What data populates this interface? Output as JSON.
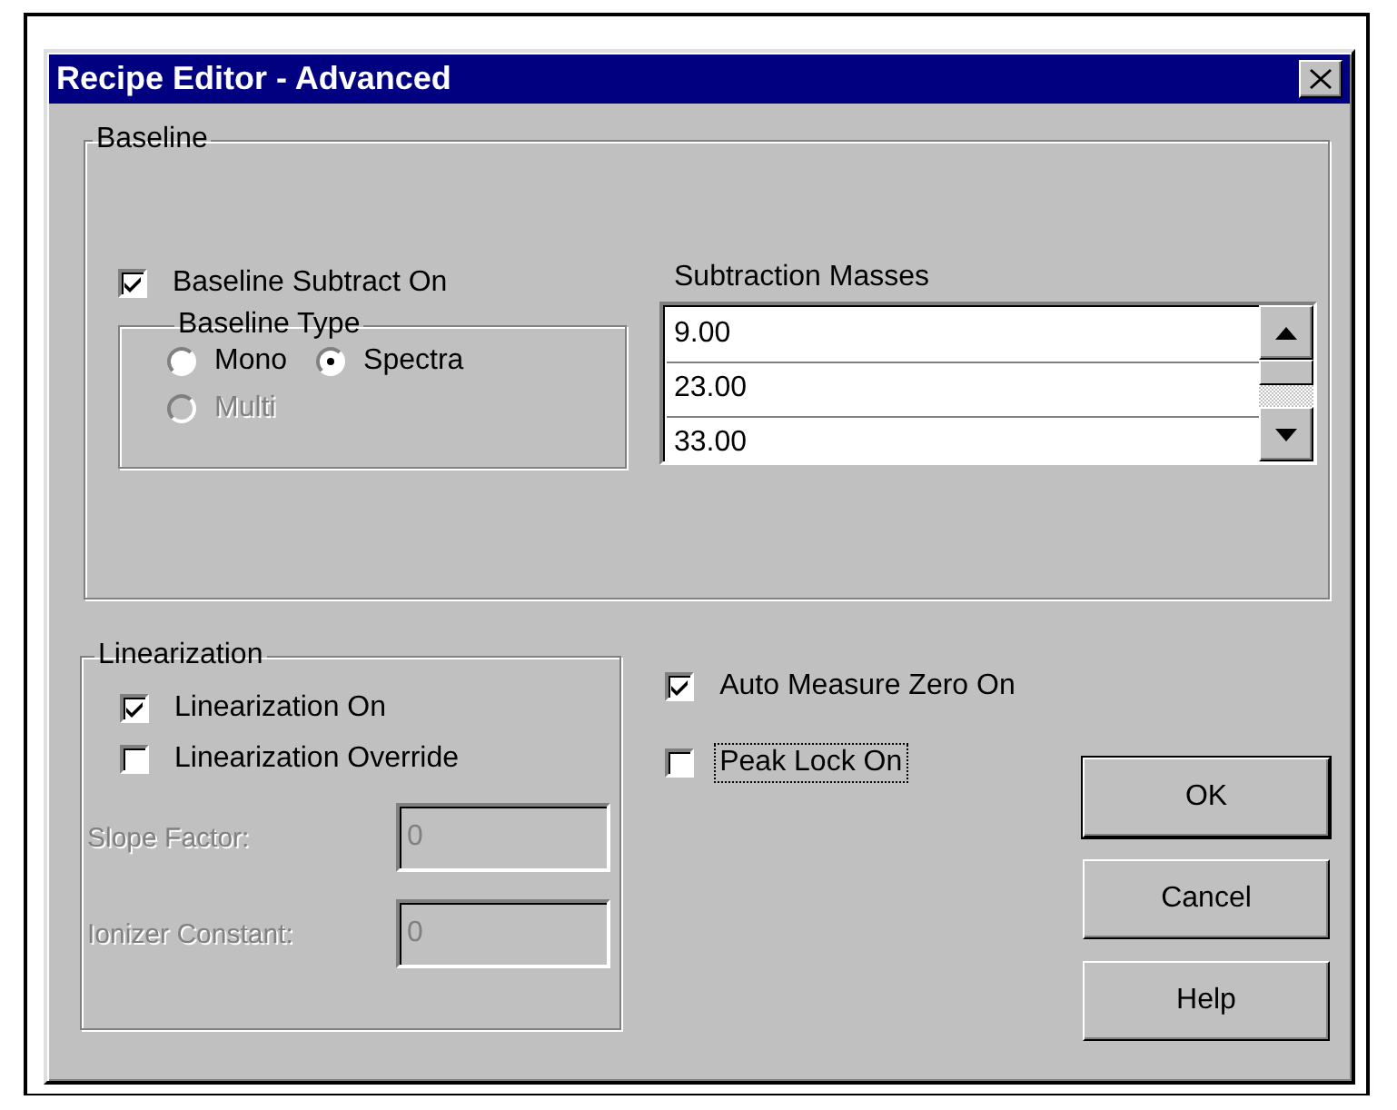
{
  "window": {
    "title": "Recipe Editor - Advanced"
  },
  "baseline": {
    "title": "Baseline",
    "subtract": {
      "label": "Baseline Subtract On",
      "checked": true
    },
    "type_group": {
      "title": "Baseline Type",
      "options": [
        {
          "label": "Mono",
          "selected": false,
          "disabled": false
        },
        {
          "label": "Spectra",
          "selected": true,
          "disabled": false
        },
        {
          "label": "Multi",
          "selected": false,
          "disabled": true
        }
      ]
    },
    "masses": {
      "label": "Subtraction Masses",
      "rows": [
        "9.00",
        "23.00",
        "33.00"
      ]
    }
  },
  "linearization": {
    "title": "Linearization",
    "checks": [
      {
        "label": "Linearization On",
        "checked": true
      },
      {
        "label": "Linearization Override",
        "checked": false
      }
    ],
    "fields": [
      {
        "label": "Slope Factor:",
        "value": "0",
        "disabled": true
      },
      {
        "label": "Ionizer Constant:",
        "value": "0",
        "disabled": true
      }
    ]
  },
  "options": [
    {
      "label": "Auto Measure Zero On",
      "checked": true,
      "focused": false
    },
    {
      "label": "Peak Lock On",
      "checked": false,
      "focused": true
    }
  ],
  "buttons": [
    {
      "label": "OK",
      "default": true
    },
    {
      "label": "Cancel",
      "default": false
    },
    {
      "label": "Help",
      "default": false
    }
  ]
}
